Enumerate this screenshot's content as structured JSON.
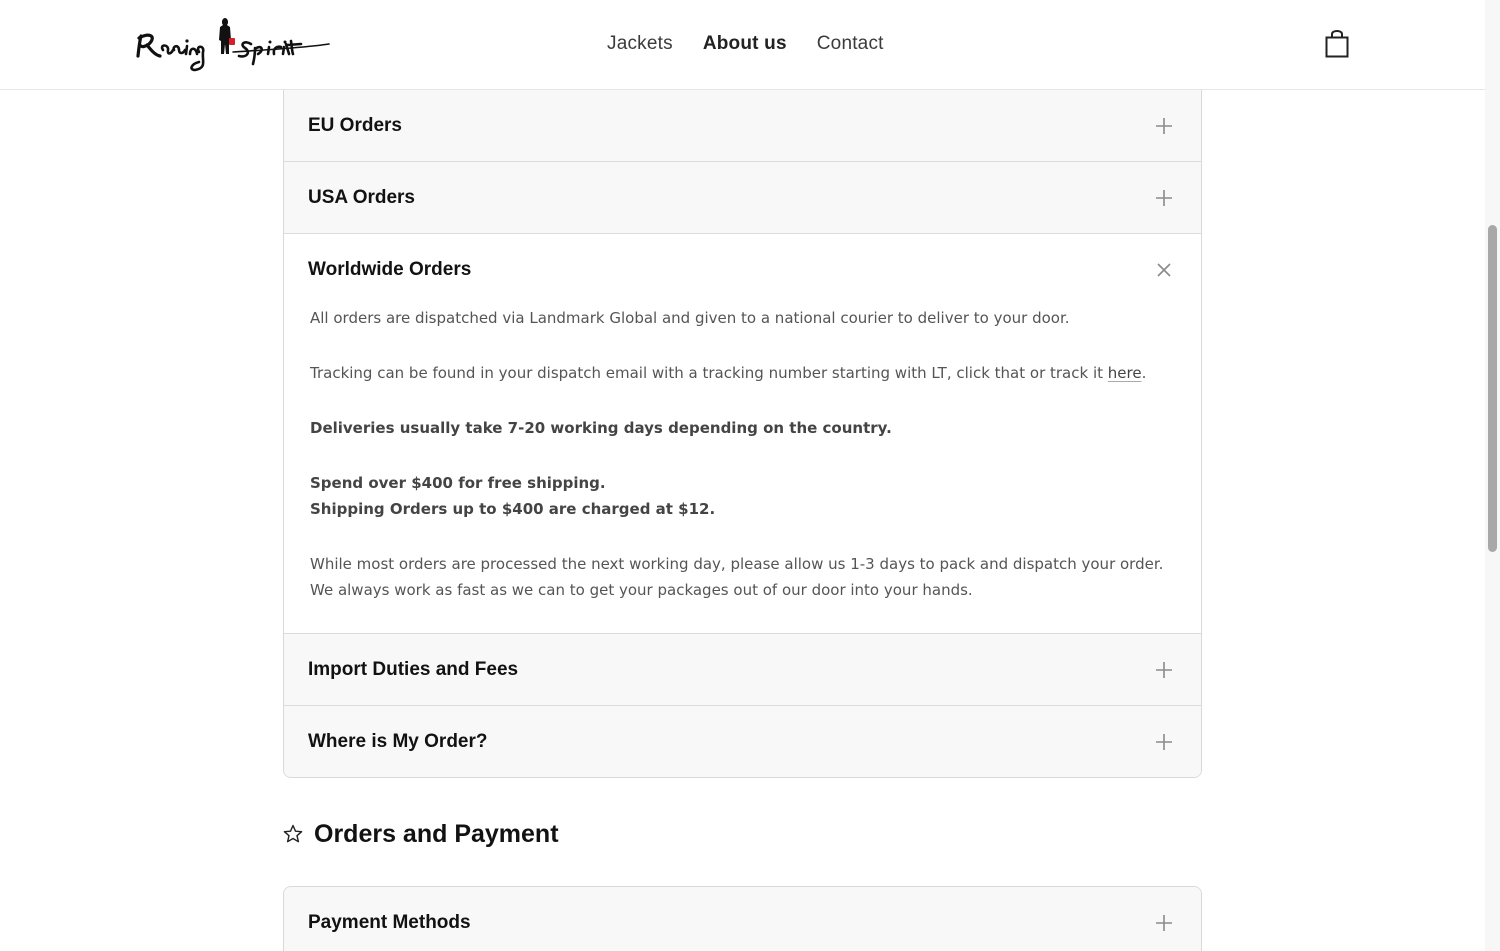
{
  "brand": {
    "logo_text": "Racing Spirit"
  },
  "nav": {
    "items": [
      {
        "label": "Jackets",
        "active": false
      },
      {
        "label": "About us",
        "active": true
      },
      {
        "label": "Contact",
        "active": false
      }
    ],
    "cart_icon": "shopping-bag-icon"
  },
  "shipping_faq": {
    "items": [
      {
        "title": "EU Orders",
        "state": "collapsed",
        "icon": "plus-icon"
      },
      {
        "title": "USA Orders",
        "state": "collapsed",
        "icon": "plus-icon"
      },
      {
        "title": "Worldwide Orders",
        "state": "expanded",
        "icon": "close-icon",
        "body": {
          "p1": "All orders are dispatched via Landmark Global and given to a national courier to deliver to your door.",
          "p2_before": "Tracking can be found in your dispatch email with a tracking number starting with LT, click that or track it ",
          "p2_link": "here",
          "p2_after": ".",
          "p3": "Deliveries usually take 7-20 working days depending on the country.",
          "p4_line1": "Spend over $400 for free shipping.",
          "p4_line2": "Shipping Orders up to $400 are charged at $12.",
          "p5_line1": "While most orders are processed the next working day, please allow us 1-3 days to pack and dispatch your order.",
          "p5_line2": "We always work as fast as we can to get your packages out of our door into your hands."
        }
      },
      {
        "title": "Import Duties and Fees",
        "state": "collapsed",
        "icon": "plus-icon"
      },
      {
        "title": "Where is My Order?",
        "state": "collapsed",
        "icon": "plus-icon"
      }
    ]
  },
  "orders_section": {
    "icon": "star-icon",
    "heading": "Orders and Payment",
    "items": [
      {
        "title": "Payment Methods",
        "state": "collapsed",
        "icon": "plus-icon"
      }
    ]
  },
  "colors": {
    "text": "#121212",
    "body_text": "#555555",
    "panel_bg": "#f8f8f8",
    "border": "#d9d9d9"
  }
}
